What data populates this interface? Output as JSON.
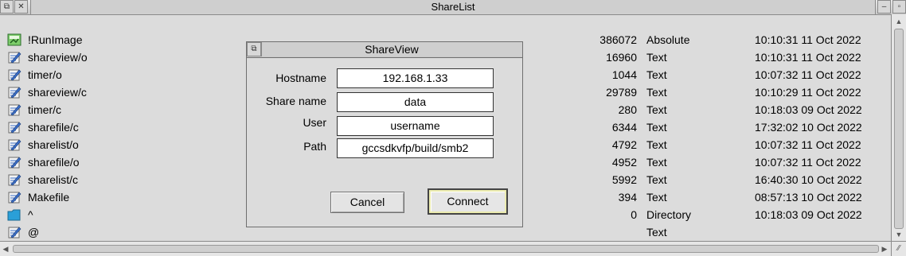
{
  "window": {
    "title": "ShareList",
    "back_icon": "back-icon",
    "close_icon": "close-icon",
    "iconise_icon": "iconise-icon",
    "toggle_size_icon": "toggle-size-icon"
  },
  "files": [
    {
      "name": "!RunImage",
      "size": "386072",
      "type": "Absolute",
      "date": "10:10:31 11 Oct 2022",
      "icon": "absolute-file-icon"
    },
    {
      "name": "shareview/o",
      "size": "16960",
      "type": "Text",
      "date": "10:10:31 11 Oct 2022",
      "icon": "text-file-icon"
    },
    {
      "name": "timer/o",
      "size": "1044",
      "type": "Text",
      "date": "10:07:32 11 Oct 2022",
      "icon": "text-file-icon"
    },
    {
      "name": "shareview/c",
      "size": "29789",
      "type": "Text",
      "date": "10:10:29 11 Oct 2022",
      "icon": "text-file-icon"
    },
    {
      "name": "timer/c",
      "size": "280",
      "type": "Text",
      "date": "10:18:03 09 Oct 2022",
      "icon": "text-file-icon"
    },
    {
      "name": "sharefile/c",
      "size": "6344",
      "type": "Text",
      "date": "17:32:02 10 Oct 2022",
      "icon": "text-file-icon"
    },
    {
      "name": "sharelist/o",
      "size": "4792",
      "type": "Text",
      "date": "10:07:32 11 Oct 2022",
      "icon": "text-file-icon"
    },
    {
      "name": "sharefile/o",
      "size": "4952",
      "type": "Text",
      "date": "10:07:32 11 Oct 2022",
      "icon": "text-file-icon"
    },
    {
      "name": "sharelist/c",
      "size": "5992",
      "type": "Text",
      "date": "16:40:30 10 Oct 2022",
      "icon": "text-file-icon"
    },
    {
      "name": "Makefile",
      "size": "394",
      "type": "Text",
      "date": "08:57:13 10 Oct 2022",
      "icon": "text-file-icon"
    },
    {
      "name": "^",
      "size": "0",
      "type": "Directory",
      "date": "10:18:03 09 Oct 2022",
      "icon": "directory-icon"
    },
    {
      "name": "@",
      "size": "",
      "type": "Text",
      "date": "",
      "icon": "text-file-icon"
    }
  ],
  "dialog": {
    "title": "ShareView",
    "fields": [
      {
        "label": "Hostname",
        "value": "192.168.1.33"
      },
      {
        "label": "Share name",
        "value": "data"
      },
      {
        "label": "User",
        "value": "username"
      },
      {
        "label": "Path",
        "value": "gccsdkvfp/build/smb2"
      }
    ],
    "cancel_label": "Cancel",
    "connect_label": "Connect"
  },
  "colors": {
    "window_background": "#dcdcdc",
    "text_file_icon": "#3b6fc9",
    "absolute_file_icon": "#2e8b2e",
    "directory_icon": "#2a9fd8",
    "default_button_highlight": "#ececb0"
  }
}
